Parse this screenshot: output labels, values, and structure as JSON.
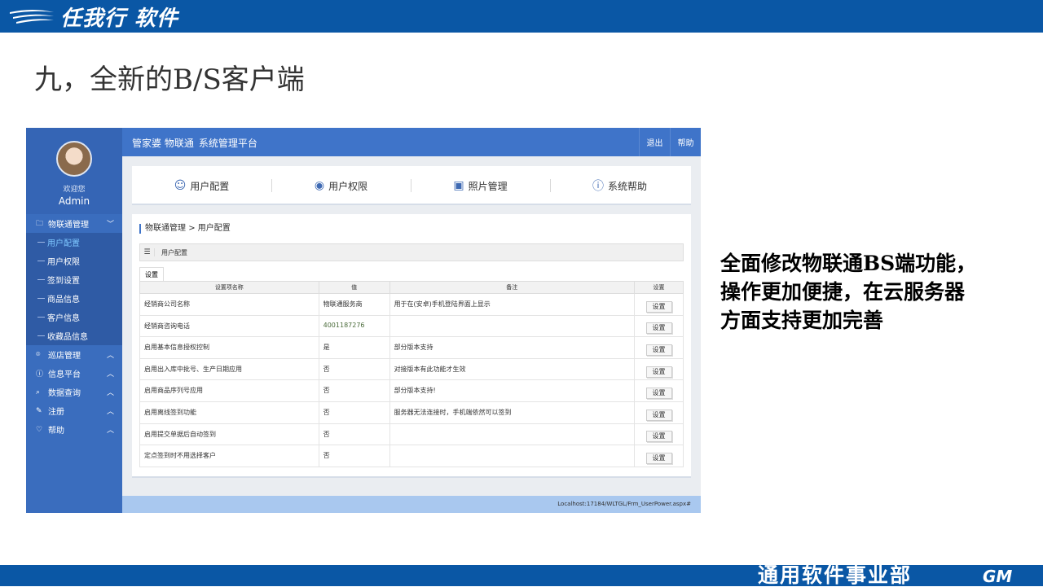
{
  "slide": {
    "logo_text": "任我行 软件",
    "title": "九，全新的B/S客户端",
    "description": "全面修改物联通BS端功能，操作更加便捷，在云服务器方面支持更加完善",
    "footer_text": "通用软件事业部",
    "footer_logo": "GM",
    "colors": {
      "bar": "#0a57a5"
    }
  },
  "app": {
    "brand": "管家婆 物联通",
    "system_name": "系统管理平台",
    "nav": {
      "logout": "退出",
      "help": "帮助"
    },
    "profile": {
      "welcome": "欢迎您",
      "user": "Admin"
    },
    "sidebar": {
      "groups": [
        {
          "label": "物联通管理",
          "icon": "folder-icon",
          "expanded": true
        },
        {
          "label": "巡店管理",
          "icon": "location-icon",
          "expanded": false
        },
        {
          "label": "信息平台",
          "icon": "info-icon",
          "expanded": false
        },
        {
          "label": "数据查询",
          "icon": "search-icon",
          "expanded": false
        },
        {
          "label": "注册",
          "icon": "edit-icon",
          "expanded": false
        },
        {
          "label": "帮助",
          "icon": "heart-icon",
          "expanded": false
        }
      ],
      "sub_items": [
        "用户配置",
        "用户权限",
        "签到设置",
        "商品信息",
        "客户信息",
        "收藏品信息"
      ],
      "active_sub": "用户配置"
    },
    "tabs": [
      {
        "label": "用户配置",
        "icon": "user-icon"
      },
      {
        "label": "用户权限",
        "icon": "permission-icon"
      },
      {
        "label": "照片管理",
        "icon": "photo-icon"
      },
      {
        "label": "系统帮助",
        "icon": "help-icon"
      }
    ],
    "breadcrumb": {
      "parent": "物联通管理",
      "separator": ">",
      "current": "用户配置"
    },
    "panel_title": "用户配置",
    "settings_tab": "设置",
    "table": {
      "headers": [
        "设置项名称",
        "值",
        "备注",
        "设置"
      ],
      "button_label": "设置",
      "rows": [
        {
          "name": "经销商公司名称",
          "value": "物联通服务商",
          "note": "用于在(安卓)手机登陆界面上显示"
        },
        {
          "name": "经销商咨询电话",
          "value": "4001187276",
          "note": ""
        },
        {
          "name": "启用基本信息授权控制",
          "value": "是",
          "note": "部分版本支持"
        },
        {
          "name": "启用出入库中批号、生产日期应用",
          "value": "否",
          "note": "对接版本有此功能才生效"
        },
        {
          "name": "启用商品序列号应用",
          "value": "否",
          "note": "部分版本支持!"
        },
        {
          "name": "启用离线签到功能",
          "value": "否",
          "note": "服务器无法连接时，手机端依然可以签到"
        },
        {
          "name": "启用提交单据后自动签到",
          "value": "否",
          "note": ""
        },
        {
          "name": "定点签到时不用选择客户",
          "value": "否",
          "note": ""
        }
      ]
    },
    "status_url": "Localhost:17184/WLTGL/Frm_UserPower.aspx#"
  }
}
